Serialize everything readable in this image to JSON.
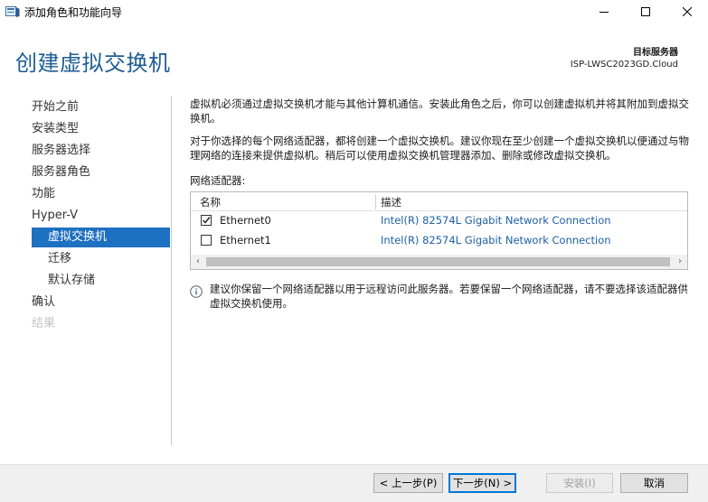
{
  "window": {
    "title": "添加角色和功能向导",
    "app_icon": "server-manager-icon",
    "controls": [
      "minimize-icon",
      "maximize-icon",
      "close-icon"
    ]
  },
  "header": {
    "title": "创建虚拟交换机",
    "server_label": "目标服务器",
    "server_name": "ISP-LWSC2023GD.Cloud"
  },
  "nav": {
    "items": [
      {
        "label": "开始之前",
        "state": "normal"
      },
      {
        "label": "安装类型",
        "state": "normal"
      },
      {
        "label": "服务器选择",
        "state": "normal"
      },
      {
        "label": "服务器角色",
        "state": "normal"
      },
      {
        "label": "功能",
        "state": "normal"
      },
      {
        "label": "Hyper-V",
        "state": "normal"
      },
      {
        "label": "虚拟交换机",
        "state": "active"
      },
      {
        "label": "迁移",
        "state": "normal"
      },
      {
        "label": "默认存储",
        "state": "normal"
      },
      {
        "label": "确认",
        "state": "normal"
      },
      {
        "label": "结果",
        "state": "disabled"
      }
    ]
  },
  "content": {
    "intro": "虚拟机必须通过虚拟交换机才能与其他计算机通信。安装此角色之后，你可以创建虚拟机并将其附加到虚拟交换机。",
    "instructions": "对于你选择的每个网络适配器，都将创建一个虚拟交换机。建议你现在至少创建一个虚拟交换机以便通过与物理网络的连接来提供虚拟机。稍后可以使用虚拟交换机管理器添加、删除或修改虚拟交换机。",
    "adapters_label": "网络适配器:",
    "table": {
      "headers": [
        "名称",
        "描述"
      ],
      "rows": [
        {
          "checked": true,
          "name": "Ethernet0",
          "description": "Intel(R) 82574L Gigabit Network Connection"
        },
        {
          "checked": false,
          "name": "Ethernet1",
          "description": "Intel(R) 82574L Gigabit Network Connection"
        }
      ]
    },
    "info": "建议你保留一个网络适配器以用于远程访问此服务器。若要保留一个网络适配器，请不要选择该适配器供虚拟交换机使用。"
  },
  "footer": {
    "prev": "< 上一步(P)",
    "next": "下一步(N) >",
    "install": "安装(I)",
    "cancel": "取消"
  }
}
